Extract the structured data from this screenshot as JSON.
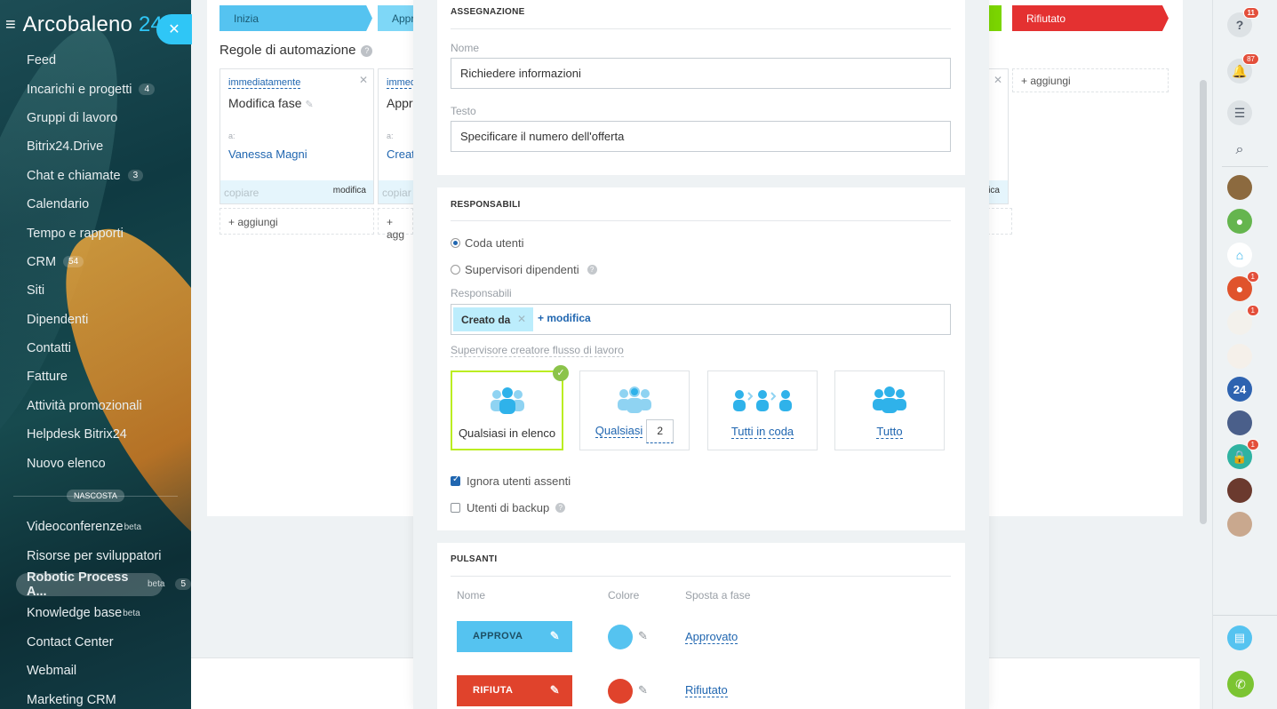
{
  "sidebar": {
    "logo_name": "Arcobaleno",
    "logo_num": "24",
    "items": [
      {
        "label": "Feed",
        "count": ""
      },
      {
        "label": "Incarichi e progetti",
        "count": "4"
      },
      {
        "label": "Gruppi di lavoro",
        "count": ""
      },
      {
        "label": "Bitrix24.Drive",
        "count": ""
      },
      {
        "label": "Chat e chiamate",
        "count": "3"
      },
      {
        "label": "Calendario",
        "count": ""
      },
      {
        "label": "Tempo e rapporti",
        "count": ""
      },
      {
        "label": "CRM",
        "count": "54"
      },
      {
        "label": "Siti",
        "count": ""
      },
      {
        "label": "Dipendenti",
        "count": ""
      },
      {
        "label": "Contatti",
        "count": ""
      },
      {
        "label": "Fatture",
        "count": ""
      },
      {
        "label": "Attività promozionali",
        "count": ""
      },
      {
        "label": "Helpdesk Bitrix24",
        "count": ""
      },
      {
        "label": "Nuovo elenco",
        "count": ""
      }
    ],
    "hidden_label": "NASCOSTA",
    "hidden_items": [
      {
        "label": "Videoconferenze",
        "sup": "beta",
        "count": ""
      },
      {
        "label": "Risorse per sviluppatori",
        "sup": "",
        "count": ""
      },
      {
        "label": "Robotic Process A...",
        "sup": "beta",
        "count": "5"
      },
      {
        "label": "Knowledge base",
        "sup": "beta",
        "count": ""
      },
      {
        "label": "Contact Center",
        "sup": "",
        "count": ""
      },
      {
        "label": "Webmail",
        "sup": "",
        "count": ""
      },
      {
        "label": "Marketing CRM",
        "sup": "",
        "count": ""
      }
    ]
  },
  "background": {
    "stages": {
      "inizia": "Inizia",
      "appr": "Appr",
      "rifiutato": "Rifiutato"
    },
    "rules_title": "Regole di automazione",
    "cards": [
      {
        "when": "immediatamente",
        "name": "Modifica fase",
        "to": "a:",
        "who": "Vanessa Magni",
        "copy": "copiare",
        "modify": "modifica"
      },
      {
        "when": "immed",
        "name": "Appr",
        "to": "a:",
        "who": "Creat",
        "copy": "copiar",
        "modify": ""
      },
      {
        "modify": "ifica"
      }
    ],
    "add_label": "+ aggiungi",
    "add_label_short": "+ agg"
  },
  "panel": {
    "assegnazione": {
      "title": "ASSEGNAZIONE",
      "name_label": "Nome",
      "name_value": "Richiedere informazioni",
      "text_label": "Testo",
      "text_value": "Specificare il numero dell'offerta"
    },
    "responsabili": {
      "title": "RESPONSABILI",
      "radio1": "Coda utenti",
      "radio2": "Supervisori dipendenti",
      "resp_label": "Responsabili",
      "tag": "Creato da",
      "tag_add": "+ modifica",
      "supervisor_label": "Supervisore creatore flusso di lavoro",
      "options": {
        "any_list": "Qualsiasi in elenco",
        "any": "Qualsiasi",
        "any_num": "2",
        "all_queue": "Tutti in coda",
        "all": "Tutto"
      },
      "ignore_absent": "Ignora utenti assenti",
      "backup_users": "Utenti di backup"
    },
    "pulsanti": {
      "title": "PULSANTI",
      "col_name": "Nome",
      "col_color": "Colore",
      "col_stage": "Sposta a fase",
      "rows": [
        {
          "label": "APPROVA",
          "color": "#55c3f0",
          "stage": "Approvato"
        },
        {
          "label": "RIFIUTA",
          "color": "#e0432c",
          "stage": "Rifiutato"
        }
      ]
    }
  },
  "rightbar": {
    "help_badge": "11",
    "bell_badge": "87",
    "avatar_badges": [
      "1",
      "1",
      "1"
    ],
    "b24": "24"
  },
  "colors": {
    "accent": "#2fc6f6",
    "link": "#2066b0",
    "approve": "#55c3f0",
    "reject": "#e0432c",
    "selected_border": "#bbed21"
  }
}
